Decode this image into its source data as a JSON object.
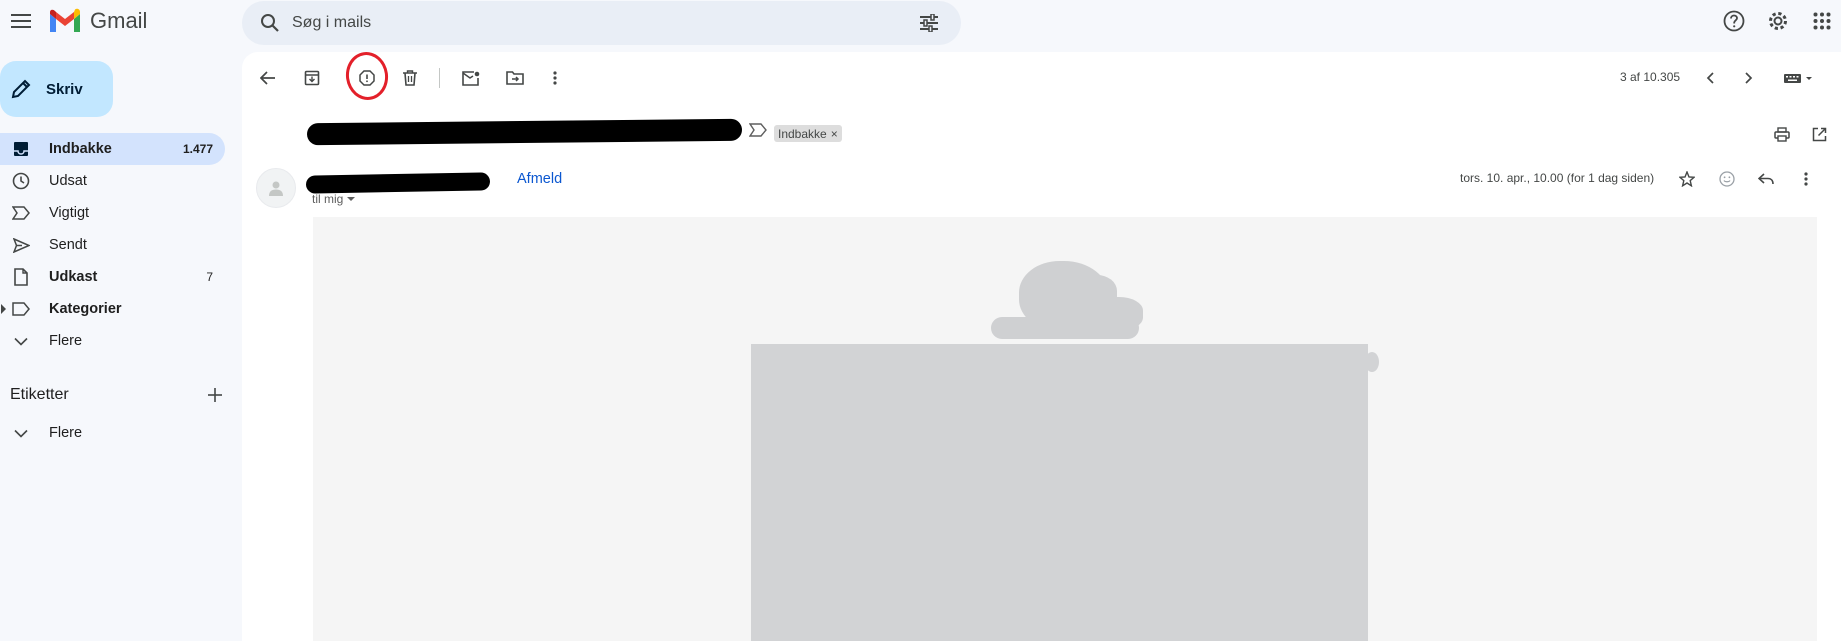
{
  "app": {
    "name": "Gmail"
  },
  "search": {
    "placeholder": "Søg i mails"
  },
  "compose": {
    "label": "Skriv"
  },
  "sidebar": {
    "items": [
      {
        "label": "Indbakke",
        "count": "1.477",
        "icon": "inbox-icon"
      },
      {
        "label": "Udsat",
        "count": "",
        "icon": "clock-icon"
      },
      {
        "label": "Vigtigt",
        "count": "",
        "icon": "important-icon"
      },
      {
        "label": "Sendt",
        "count": "",
        "icon": "send-icon"
      },
      {
        "label": "Udkast",
        "count": "7",
        "icon": "draft-icon"
      },
      {
        "label": "Kategorier",
        "count": "",
        "icon": "label-icon"
      },
      {
        "label": "Flere",
        "count": "",
        "icon": "chevron-down-icon"
      }
    ],
    "labels_title": "Etiketter",
    "labels_more": "Flere"
  },
  "toolbar": {
    "pager": "3 af 10.305",
    "icons": [
      "back-arrow-icon",
      "archive-icon",
      "report-spam-icon",
      "delete-icon",
      "mark-unread-icon",
      "move-to-icon",
      "more-vert-icon",
      "prev-icon",
      "next-icon",
      "input-tools-icon"
    ]
  },
  "email": {
    "label_chip": "Indbakke",
    "label_chip_close": "×",
    "unsubscribe": "Afmeld",
    "to": "til mig",
    "date": "tors. 10. apr., 10.00 (for 1 dag siden)"
  },
  "colors": {
    "accent": "#0b57d0",
    "compose_bg": "#c2e7ff",
    "active_nav": "#d3e3fd",
    "annotation_circle": "#e3202a"
  }
}
